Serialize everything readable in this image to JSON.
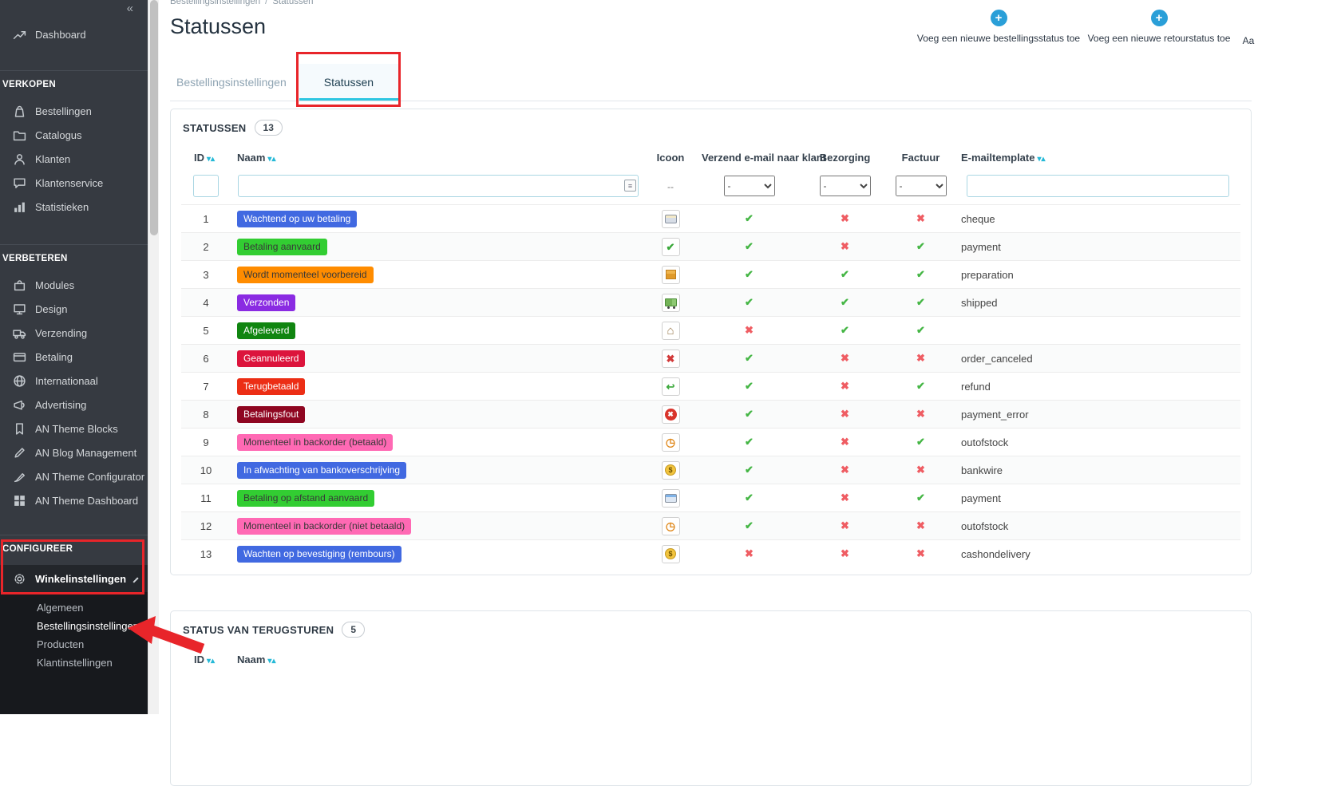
{
  "colors": {
    "annotation": "#e8252a",
    "accent": "#25b9d7",
    "check": "#45b645",
    "cross": "#ef5d63"
  },
  "sidebar": {
    "collapse_icon": "«",
    "dashboard": {
      "label": "Dashboard",
      "icon": "trend"
    },
    "sections": [
      {
        "title": "VERKOPEN",
        "items": [
          {
            "label": "Bestellingen",
            "icon": "orders"
          },
          {
            "label": "Catalogus",
            "icon": "catalog"
          },
          {
            "label": "Klanten",
            "icon": "customers"
          },
          {
            "label": "Klantenservice",
            "icon": "service"
          },
          {
            "label": "Statistieken",
            "icon": "stats"
          }
        ]
      },
      {
        "title": "VERBETEREN",
        "items": [
          {
            "label": "Modules",
            "icon": "modules"
          },
          {
            "label": "Design",
            "icon": "design"
          },
          {
            "label": "Verzending",
            "icon": "shipping"
          },
          {
            "label": "Betaling",
            "icon": "payment"
          },
          {
            "label": "Internationaal",
            "icon": "globe"
          },
          {
            "label": "Advertising",
            "icon": "megaphone"
          },
          {
            "label": "AN Theme Blocks",
            "icon": "bookmark"
          },
          {
            "label": "AN Blog Management",
            "icon": "pencil"
          },
          {
            "label": "AN Theme Configurator",
            "icon": "brush"
          },
          {
            "label": "AN Theme Dashboard",
            "icon": "grid"
          }
        ]
      }
    ],
    "configure": {
      "title": "CONFIGUREER",
      "item": {
        "label": "Winkelinstellingen",
        "icon": "gear"
      },
      "submenu": [
        {
          "label": "Algemeen",
          "current": false
        },
        {
          "label": "Bestellingsinstellingen",
          "current": true
        },
        {
          "label": "Producten",
          "current": false
        },
        {
          "label": "Klantinstellingen",
          "current": false
        }
      ]
    }
  },
  "header": {
    "breadcrumb": {
      "parent": "Bestellingsinstellingen",
      "separator": "/",
      "current": "Statussen"
    },
    "title": "Statussen",
    "actions": [
      {
        "label": "Voeg een nieuwe bestellingsstatus toe"
      },
      {
        "label": "Voeg een nieuwe retourstatus toe"
      },
      {
        "label": "Aa"
      }
    ]
  },
  "tabs": [
    {
      "label": "Bestellingsinstellingen",
      "active": false
    },
    {
      "label": "Statussen",
      "active": true
    }
  ],
  "statuses_panel": {
    "title": "STATUSSEN",
    "count": "13",
    "columns": {
      "id": "ID",
      "name": "Naam",
      "icon": "Icoon",
      "email": "Verzend e-mail naar klant",
      "delivery": "Bezorging",
      "invoice": "Factuur",
      "template": "E-mailtemplate"
    },
    "filter": {
      "icon_placeholder": "--",
      "select_value": "-"
    },
    "rows": [
      {
        "id": "1",
        "name": "Wachtend op uw betaling",
        "color": "#4169E1",
        "icon": "card",
        "email": true,
        "delivery": false,
        "invoice": false,
        "template": "cheque"
      },
      {
        "id": "2",
        "name": "Betaling aanvaard",
        "color": "#32CD32",
        "icon": "check",
        "email": true,
        "delivery": false,
        "invoice": true,
        "template": "payment"
      },
      {
        "id": "3",
        "name": "Wordt momenteel voorbereid",
        "color": "#FF8C00",
        "icon": "package",
        "email": true,
        "delivery": true,
        "invoice": true,
        "template": "preparation"
      },
      {
        "id": "4",
        "name": "Verzonden",
        "color": "#8A2BE2",
        "icon": "truck",
        "email": true,
        "delivery": true,
        "invoice": true,
        "template": "shipped"
      },
      {
        "id": "5",
        "name": "Afgeleverd",
        "color": "#108510",
        "icon": "home",
        "email": false,
        "delivery": true,
        "invoice": true,
        "template": ""
      },
      {
        "id": "6",
        "name": "Geannuleerd",
        "color": "#DC143C",
        "icon": "cross",
        "email": true,
        "delivery": false,
        "invoice": false,
        "template": "order_canceled"
      },
      {
        "id": "7",
        "name": "Terugbetaald",
        "color": "#EC2E15",
        "icon": "refund",
        "email": true,
        "delivery": false,
        "invoice": true,
        "template": "refund"
      },
      {
        "id": "8",
        "name": "Betalingsfout",
        "color": "#8F0621",
        "icon": "error",
        "email": true,
        "delivery": false,
        "invoice": false,
        "template": "payment_error"
      },
      {
        "id": "9",
        "name": "Momenteel in backorder (betaald)",
        "color": "#FF69B4",
        "icon": "clock",
        "email": true,
        "delivery": false,
        "invoice": true,
        "template": "outofstock"
      },
      {
        "id": "10",
        "name": "In afwachting van bankoverschrijving",
        "color": "#4169E1",
        "icon": "money",
        "email": true,
        "delivery": false,
        "invoice": false,
        "template": "bankwire"
      },
      {
        "id": "11",
        "name": "Betaling op afstand aanvaard",
        "color": "#32CD32",
        "icon": "remote",
        "email": true,
        "delivery": false,
        "invoice": true,
        "template": "payment"
      },
      {
        "id": "12",
        "name": "Momenteel in backorder (niet betaald)",
        "color": "#FF69B4",
        "icon": "clock",
        "email": true,
        "delivery": false,
        "invoice": false,
        "template": "outofstock"
      },
      {
        "id": "13",
        "name": "Wachten op bevestiging (rembours)",
        "color": "#4169E1",
        "icon": "money",
        "email": false,
        "delivery": false,
        "invoice": false,
        "template": "cashondelivery"
      }
    ]
  },
  "returns_panel": {
    "title": "STATUS VAN TERUGSTUREN",
    "count": "5",
    "columns": {
      "id": "ID",
      "name": "Naam"
    }
  }
}
